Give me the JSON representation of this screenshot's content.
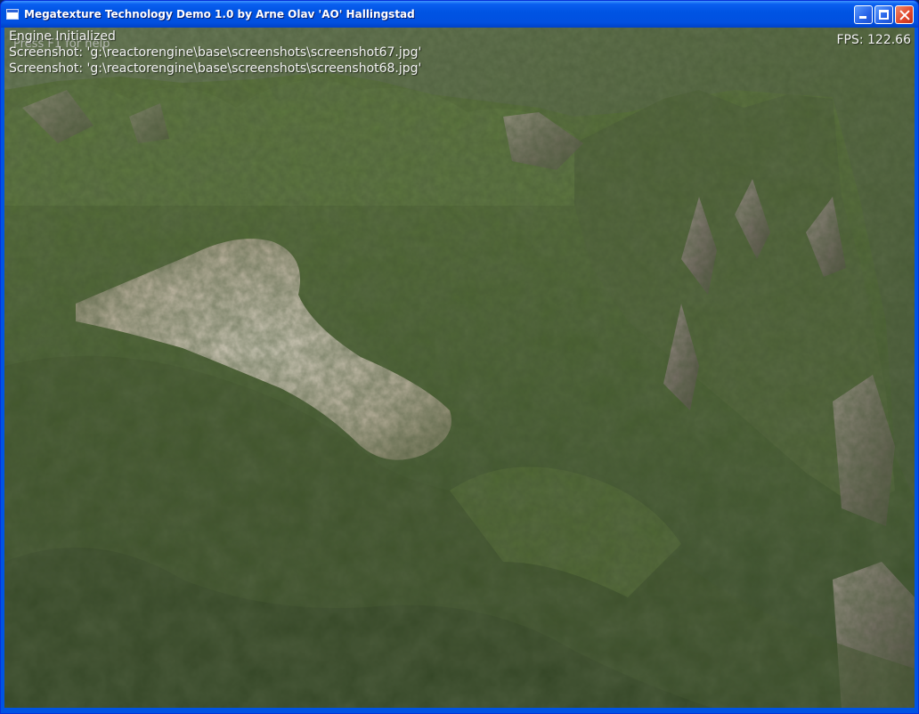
{
  "window": {
    "title": "Megatexture Technology Demo 1.0 by Arne Olav 'AO' Hallingstad"
  },
  "hud": {
    "console_lines": [
      "Engine Initialized",
      "Screenshot: 'g:\\reactorengine\\base\\screenshots\\screenshot67.jpg'",
      "Screenshot: 'g:\\reactorengine\\base\\screenshots\\screenshot68.jpg'"
    ],
    "help_hint": "Press F1 for help",
    "fps_label": "FPS: 122.66"
  },
  "icons": {
    "app": "app-window-icon",
    "minimize": "minimize-icon",
    "maximize": "maximize-icon",
    "close": "close-icon"
  },
  "colors": {
    "titlebar": "#0054e3",
    "close_button": "#e0452a",
    "terrain_grass": "#4d6a34",
    "terrain_dark": "#2c3a22",
    "terrain_path": "#d8cfc0",
    "rock": "#9a8f88",
    "sky_terrain_far": "#5b6d4c"
  }
}
